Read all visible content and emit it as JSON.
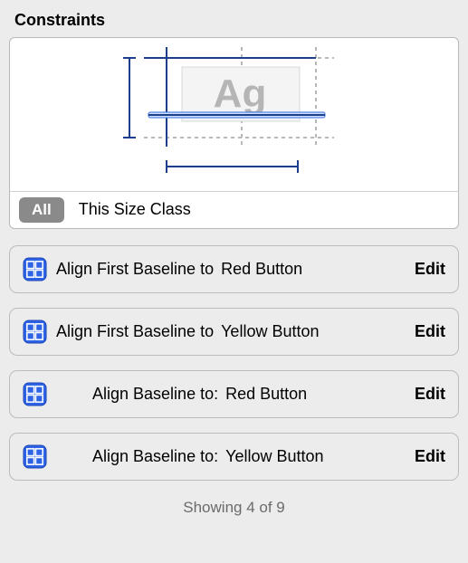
{
  "panel": {
    "title": "Constraints",
    "preview_glyph": "Ag",
    "scope": {
      "all_label": "All",
      "this_label": "This Size Class"
    }
  },
  "constraints": [
    {
      "relation": "Align First Baseline to",
      "target": "Red Button",
      "edit": "Edit",
      "indent": false
    },
    {
      "relation": "Align First Baseline to",
      "target": "Yellow Button",
      "edit": "Edit",
      "indent": false
    },
    {
      "relation": "Align Baseline to:",
      "target": "Red Button",
      "edit": "Edit",
      "indent": true
    },
    {
      "relation": "Align Baseline to:",
      "target": "Yellow Button",
      "edit": "Edit",
      "indent": true
    }
  ],
  "footer": {
    "showing": "Showing 4 of 9"
  },
  "counts": {
    "shown": 4,
    "total": 9
  }
}
